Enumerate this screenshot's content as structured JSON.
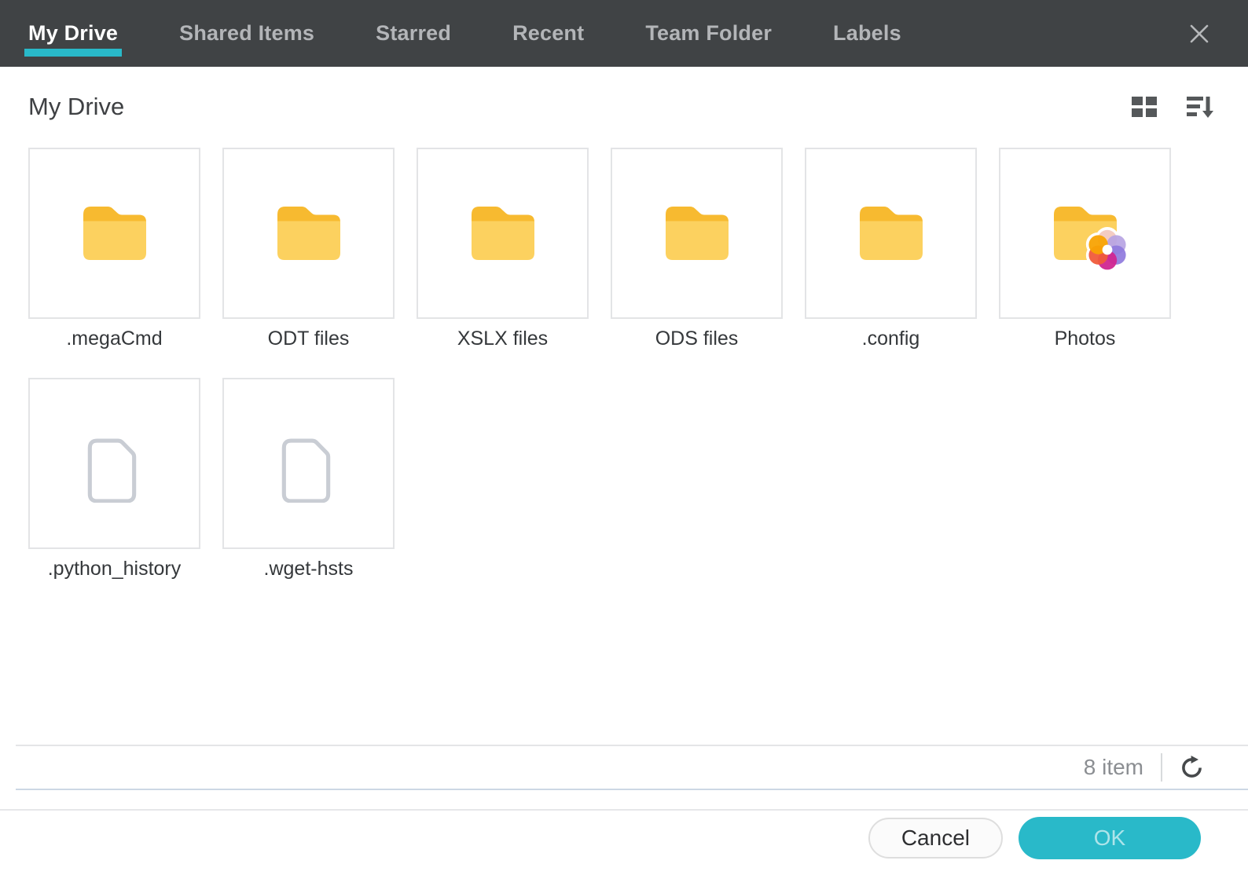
{
  "tab_bar": {
    "tabs": [
      {
        "label": "My Drive",
        "active": true
      },
      {
        "label": "Shared Items",
        "active": false
      },
      {
        "label": "Starred",
        "active": false
      },
      {
        "label": "Recent",
        "active": false
      },
      {
        "label": "Team Folder",
        "active": false
      },
      {
        "label": "Labels",
        "active": false
      }
    ]
  },
  "header": {
    "title": "My Drive"
  },
  "grid": {
    "items": [
      {
        "label": ".megaCmd",
        "type": "folder"
      },
      {
        "label": "ODT files",
        "type": "folder"
      },
      {
        "label": "XSLX files",
        "type": "folder"
      },
      {
        "label": "ODS files",
        "type": "folder"
      },
      {
        "label": ".config",
        "type": "folder"
      },
      {
        "label": "Photos",
        "type": "folder-photos"
      },
      {
        "label": ".python_history",
        "type": "file"
      },
      {
        "label": ".wget-hsts",
        "type": "file"
      }
    ]
  },
  "status_bar": {
    "item_count": "8 item"
  },
  "footer": {
    "cancel_label": "Cancel",
    "ok_label": "OK"
  },
  "colors": {
    "accent_teal": "#29b9c9",
    "tab_bar_bg": "#404345",
    "folder_top": "#f7ba30",
    "folder_body": "#fcd15f"
  },
  "icons": {
    "view": "grid-view-icon",
    "sort": "sort-descending-icon",
    "close": "close-icon",
    "refresh": "refresh-icon",
    "folder": "folder-icon",
    "file": "file-icon",
    "photos_badge": "photos-flower-icon"
  }
}
